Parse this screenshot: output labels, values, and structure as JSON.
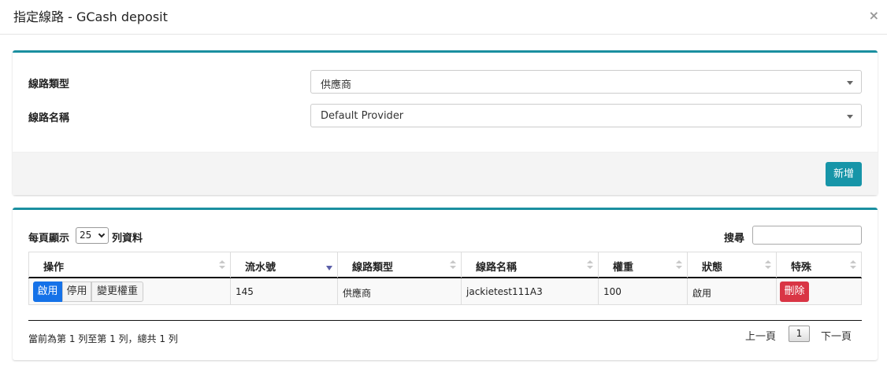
{
  "modal": {
    "title": "指定線路 - GCash deposit",
    "close_label": "×"
  },
  "form": {
    "route_type_label": "線路類型",
    "route_type_value": "供應商",
    "route_name_label": "線路名稱",
    "route_name_value": "Default Provider",
    "add_button": "新增"
  },
  "table_controls": {
    "length_prefix": "每頁顯示",
    "length_value": "25",
    "length_suffix": "列資料",
    "search_label": "搜尋",
    "search_value": ""
  },
  "table": {
    "headers": [
      "操作",
      "流水號",
      "線路類型",
      "線路名稱",
      "權重",
      "狀態",
      "特殊"
    ],
    "sorted_column": "流水號",
    "sort_direction": "desc",
    "rows": [
      {
        "actions": [
          "啟用",
          "停用",
          "變更權重"
        ],
        "active_action": "啟用",
        "serial": "145",
        "route_type": "供應商",
        "route_name": "jackietest111A3",
        "weight": "100",
        "status": "啟用",
        "special": "刪除"
      }
    ]
  },
  "pagination": {
    "info": "當前為第 1 列至第 1 列，總共 1 列",
    "prev": "上一頁",
    "current": "1",
    "next": "下一頁"
  },
  "colors": {
    "accent": "#1a8fa0",
    "add_button": "#1795a8",
    "active_button": "#1572e8",
    "delete_button": "#d93545"
  }
}
